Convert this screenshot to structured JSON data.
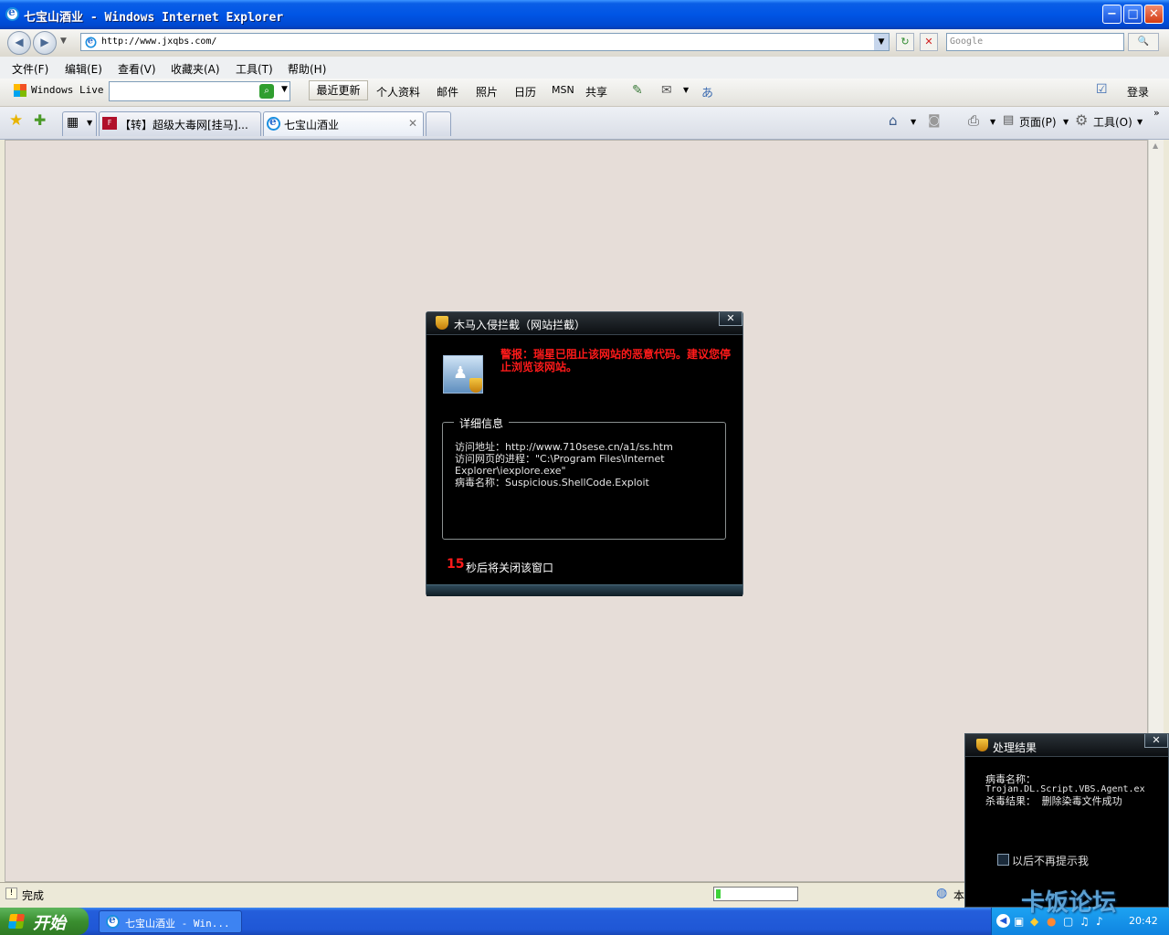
{
  "window": {
    "title": "七宝山酒业 - Windows Internet Explorer",
    "minimize": "−",
    "maximize": "□",
    "close": "✕"
  },
  "address": {
    "url": "http://www.jxqbs.com/",
    "search_placeholder": "Google",
    "refresh": "↻",
    "stop": "✕",
    "search_go": "🔍"
  },
  "menu": [
    "文件(F)",
    "编辑(E)",
    "查看(V)",
    "收藏夹(A)",
    "工具(T)",
    "帮助(H)"
  ],
  "links": {
    "windows_live": "Windows Live",
    "recent": "最近更新",
    "items": [
      "个人资料",
      "邮件",
      "照片",
      "日历",
      "MSN",
      "共享"
    ],
    "login": "登录"
  },
  "tabs": {
    "items": [
      {
        "label": "【转】超级大毒网[挂马]..."
      },
      {
        "label": "七宝山酒业"
      }
    ],
    "page_menu": "页面(P)",
    "tools_menu": "工具(O)"
  },
  "alert_dialog": {
    "title": "木马入侵拦截（网站拦截）",
    "warning": "警报：瑞星已阻止该网站的恶意代码。建议您停止浏览该网站。",
    "details_legend": "详细信息",
    "details_lines": [
      "访问地址：http://www.710sese.cn/a1/ss.htm",
      "访问网页的进程：\"C:\\Program Files\\Internet",
      "Explorer\\iexplore.exe\"",
      "病毒名称：Suspicious.ShellCode.Exploit"
    ],
    "countdown": "15",
    "countdown_text": "秒后将关闭该窗口"
  },
  "result_dialog": {
    "title": "处理结果",
    "virus_label": "病毒名称：",
    "virus_name": "Trojan.DL.Script.VBS.Agent.ex",
    "result": "杀毒结果： 删除染毒文件成功",
    "checkbox_label": "以后不再提示我"
  },
  "status": {
    "text": "完成",
    "progress": 0.06,
    "zone": "本"
  },
  "taskbar": {
    "start": "开始",
    "item": "七宝山酒业 - Win...",
    "clock": "20:42",
    "watermark": "卡饭论坛"
  },
  "colors": {
    "warning": "#ff1a1a",
    "countdown": "#ff1a1a",
    "dialog_bg": "#000000",
    "page_bg": "#e6ddd8"
  }
}
